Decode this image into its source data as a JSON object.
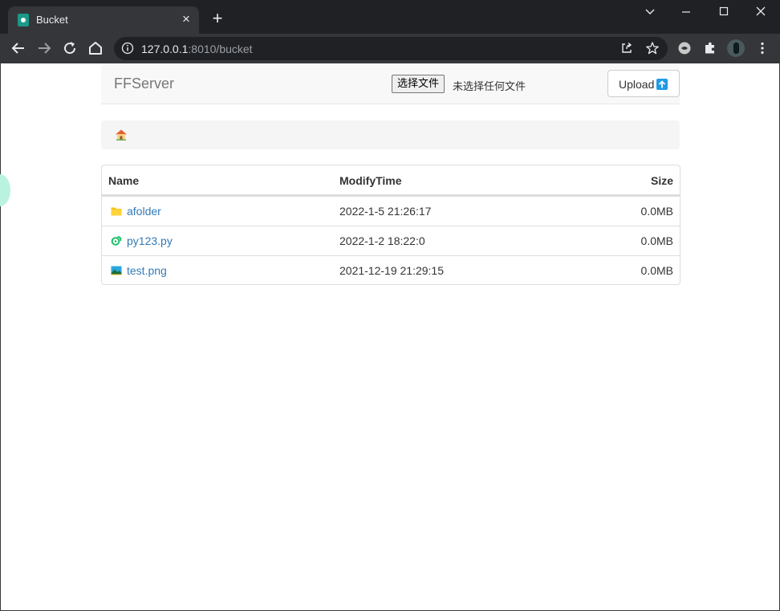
{
  "browser": {
    "tab_title": "Bucket",
    "url_host": "127.0.0.1",
    "url_rest": ":8010/bucket"
  },
  "navbar": {
    "brand": "FFServer",
    "choose_file_label": "选择文件",
    "no_file_text": "未选择任何文件",
    "upload_label": "Upload"
  },
  "table": {
    "headers": {
      "name": "Name",
      "time": "ModifyTime",
      "size": "Size"
    },
    "rows": [
      {
        "icon": "folder-icon",
        "name": "afolder",
        "time": "2022-1-5 21:26:17",
        "size": "0.0MB"
      },
      {
        "icon": "python-file-icon",
        "name": "py123.py",
        "time": "2022-1-2 18:22:0",
        "size": "0.0MB"
      },
      {
        "icon": "image-file-icon",
        "name": "test.png",
        "time": "2021-12-19 21:29:15",
        "size": "0.0MB"
      }
    ]
  },
  "colors": {
    "link": "#337ab7",
    "accent_upload": "#1e9be6",
    "favicon": "#1a9a87"
  }
}
